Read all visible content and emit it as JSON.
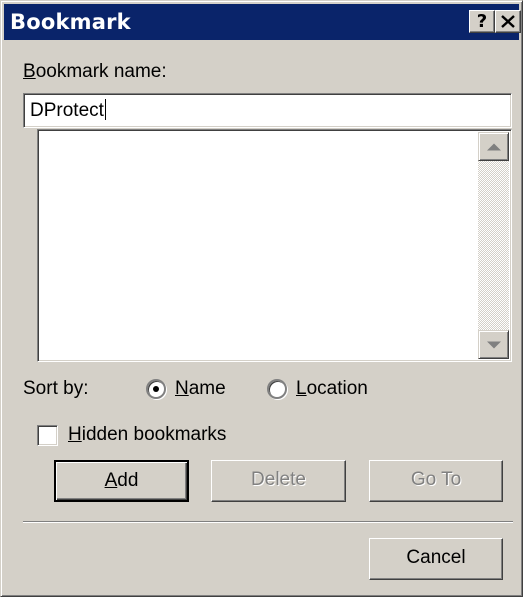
{
  "window": {
    "title": "Bookmark",
    "help_button": "?",
    "close_button": "X"
  },
  "bookmark_name": {
    "label_accel": "B",
    "label_rest": "ookmark name:",
    "value": "DProtect"
  },
  "bookmark_list": {
    "items": []
  },
  "sort": {
    "label": "Sort by:",
    "options": [
      {
        "accel": "N",
        "rest": "ame",
        "selected": true
      },
      {
        "accel": "L",
        "rest": "ocation",
        "selected": false
      }
    ]
  },
  "hidden_bookmarks": {
    "accel": "H",
    "rest": "idden bookmarks",
    "checked": false
  },
  "buttons": {
    "add": {
      "accel": "A",
      "rest": "dd"
    },
    "delete": "Delete",
    "goto": "Go To",
    "cancel": "Cancel"
  },
  "colors": {
    "titlebar": "#0a246a",
    "face": "#d4d0c8",
    "disabled_text": "#808080"
  }
}
